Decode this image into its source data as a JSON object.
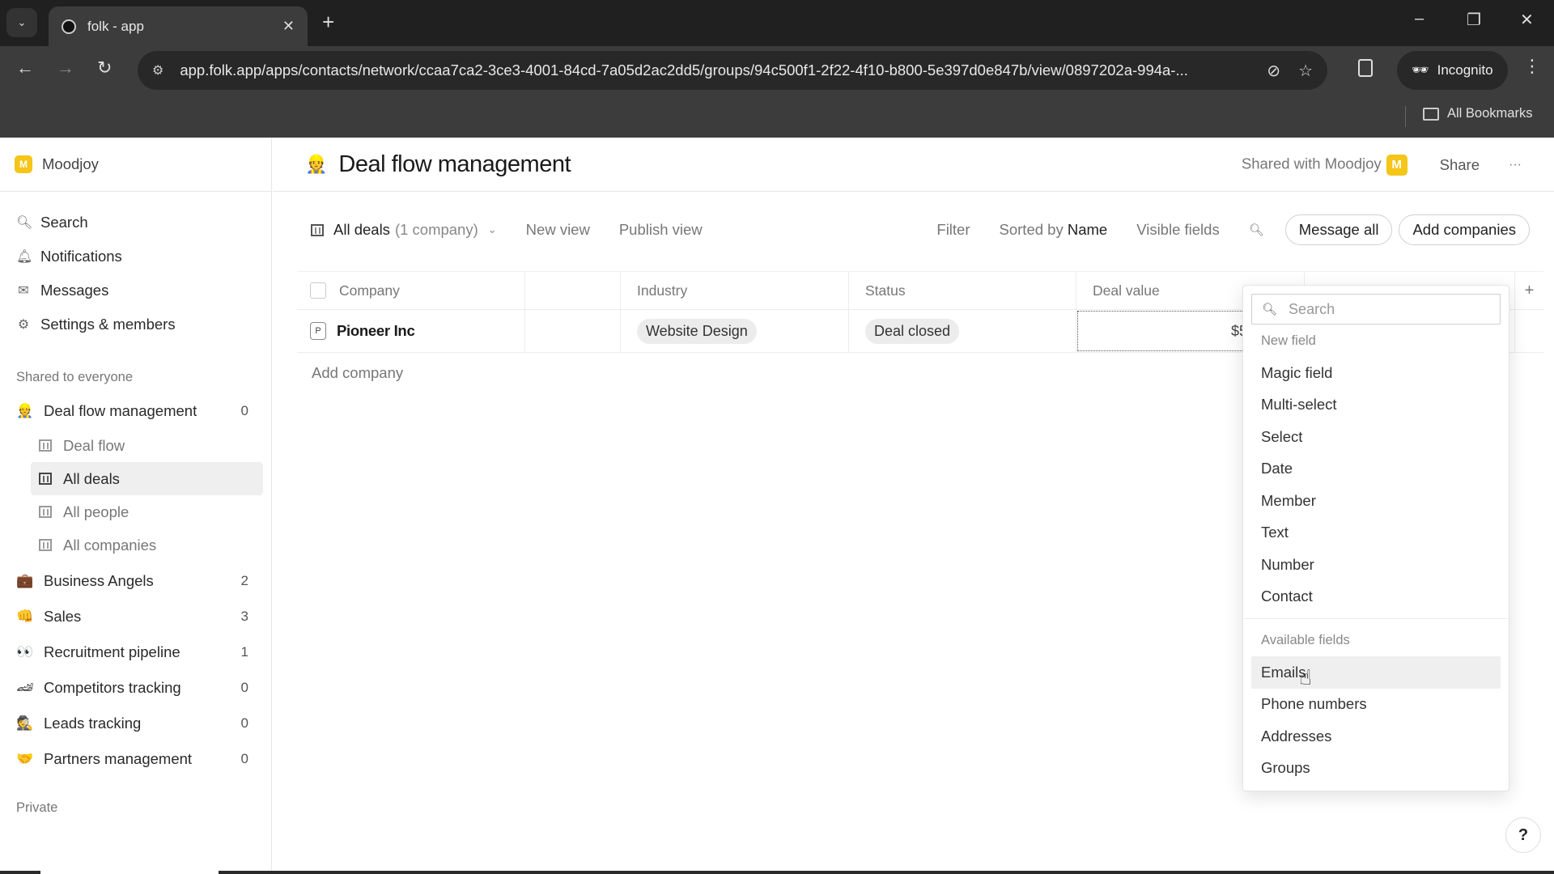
{
  "browser": {
    "tab_title": "folk - app",
    "url": "app.folk.app/apps/contacts/network/ccaa7ca2-3ce3-4001-84cd-7a05d2ac2dd5/groups/94c500f1-2f22-4f10-b800-5e397d0e847b/view/0897202a-994a-...",
    "profile_label": "Incognito",
    "bookmarks_label": "All Bookmarks"
  },
  "workspace": {
    "logo_letter": "M",
    "name": "Moodjoy",
    "brand_color": "#f5c518"
  },
  "sidebar": {
    "nav": [
      {
        "label": "Search",
        "icon": "search-icon"
      },
      {
        "label": "Notifications",
        "icon": "bell-icon"
      },
      {
        "label": "Messages",
        "icon": "mail-icon"
      },
      {
        "label": "Settings & members",
        "icon": "gear-icon"
      }
    ],
    "shared_label": "Shared to everyone",
    "groups": [
      {
        "emoji": "👷",
        "label": "Deal flow management",
        "count": "0",
        "views": [
          {
            "label": "Deal flow",
            "icon": "kanban-icon"
          },
          {
            "label": "All deals",
            "icon": "table-icon",
            "active": true
          },
          {
            "label": "All people",
            "icon": "table-icon"
          },
          {
            "label": "All companies",
            "icon": "table-icon"
          }
        ]
      },
      {
        "emoji": "💼",
        "label": "Business Angels",
        "count": "2"
      },
      {
        "emoji": "👊",
        "label": "Sales",
        "count": "3"
      },
      {
        "emoji": "👀",
        "label": "Recruitment pipeline",
        "count": "1"
      },
      {
        "emoji": "🏎",
        "label": "Competitors tracking",
        "count": "0"
      },
      {
        "emoji": "🕵",
        "label": "Leads tracking",
        "count": "0"
      },
      {
        "emoji": "🤝",
        "label": "Partners management",
        "count": "0"
      }
    ],
    "private_label": "Private"
  },
  "header": {
    "emoji": "👷",
    "title": "Deal flow management",
    "shared_with": "Shared with Moodjoy",
    "avatar_letter": "M",
    "share_label": "Share",
    "more_label": "···"
  },
  "toolbar": {
    "view_name": "All deals",
    "view_count": "(1 company)",
    "new_view": "New view",
    "publish_view": "Publish view",
    "filter": "Filter",
    "sorted_by_prefix": "Sorted by",
    "sorted_by_value": "Name",
    "visible_fields": "Visible fields",
    "message_all": "Message all",
    "add_companies": "Add companies"
  },
  "table": {
    "columns": [
      "Company",
      "",
      "Industry",
      "Status",
      "Deal value",
      ""
    ],
    "rows": [
      {
        "avatar": "P",
        "company": "Pioneer Inc",
        "industry": "Website Design",
        "status": "Deal closed",
        "deal_value": "$5"
      }
    ],
    "add_row_label": "Add company",
    "add_column_label": "+"
  },
  "field_menu": {
    "search_placeholder": "Search",
    "new_field_label": "New field",
    "new_field_types": [
      "Magic field",
      "Multi-select",
      "Select",
      "Date",
      "Member",
      "Text",
      "Number",
      "Contact"
    ],
    "available_label": "Available fields",
    "available_fields": [
      "Emails",
      "Phone numbers",
      "Addresses",
      "Groups"
    ],
    "hovered": "Emails"
  },
  "help_label": "?"
}
